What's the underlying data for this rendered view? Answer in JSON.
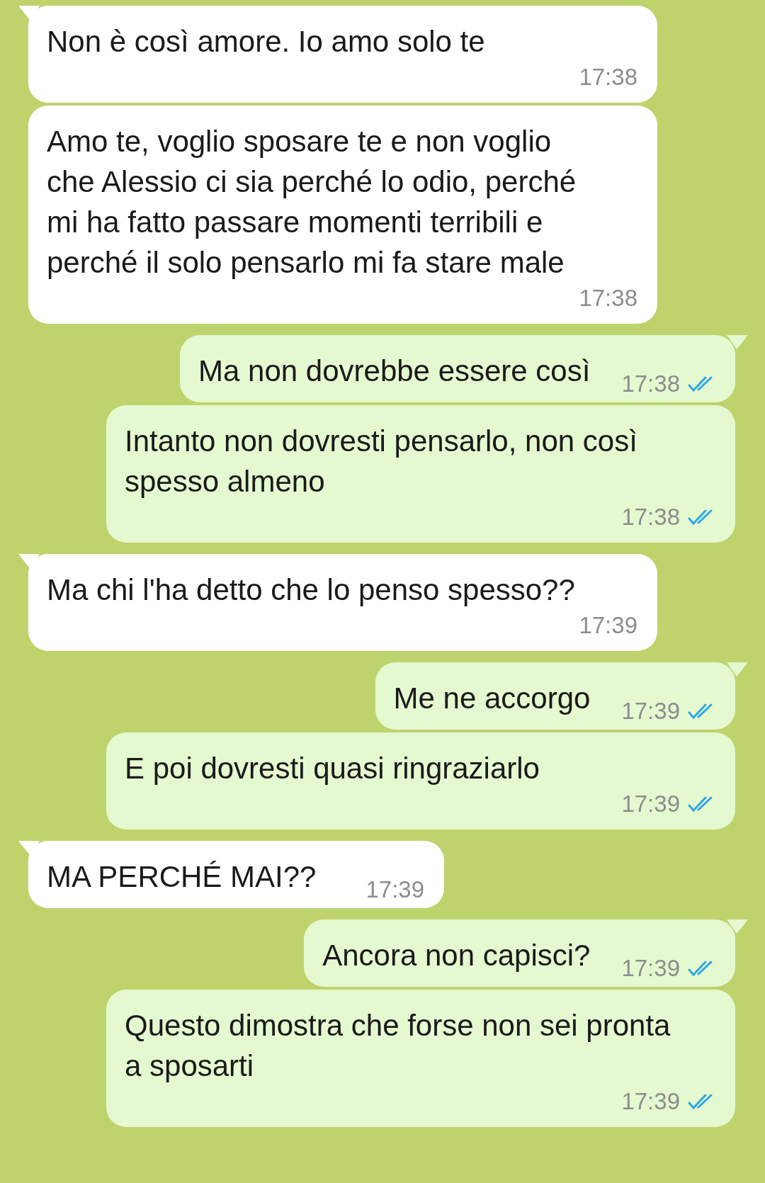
{
  "messages": [
    {
      "kind": "incoming",
      "text": "Non è così amore. Io amo solo te",
      "time": "17:38",
      "wide": true
    },
    {
      "kind": "incoming",
      "text": "Amo te, voglio sposare te e non voglio che Alessio ci sia perché lo odio, perché mi ha fatto passare momenti terribili e perché il solo pensarlo mi fa stare male",
      "time": "17:38",
      "wide": true
    },
    {
      "kind": "outgoing",
      "text": "Ma non dovrebbe essere così",
      "time": "17:38",
      "read": true,
      "wide": false
    },
    {
      "kind": "outgoing",
      "text": "Intanto non dovresti pensarlo, non così spesso almeno",
      "time": "17:38",
      "read": true,
      "wide": true
    },
    {
      "kind": "incoming",
      "text": "Ma chi l'ha detto che lo penso spesso??",
      "time": "17:39",
      "wide": true
    },
    {
      "kind": "outgoing",
      "text": "Me ne accorgo",
      "time": "17:39",
      "read": true,
      "wide": false
    },
    {
      "kind": "outgoing",
      "text": "E poi dovresti quasi ringraziarlo",
      "time": "17:39",
      "read": true,
      "wide": true
    },
    {
      "kind": "incoming",
      "text": "MA PERCHÉ MAI??",
      "time": "17:39",
      "wide": false
    },
    {
      "kind": "outgoing",
      "text": "Ancora non capisci?",
      "time": "17:39",
      "read": true,
      "wide": false
    },
    {
      "kind": "outgoing",
      "text": "Questo dimostra che forse non sei pronta a sposarti",
      "time": "17:39",
      "read": true,
      "wide": true
    }
  ]
}
